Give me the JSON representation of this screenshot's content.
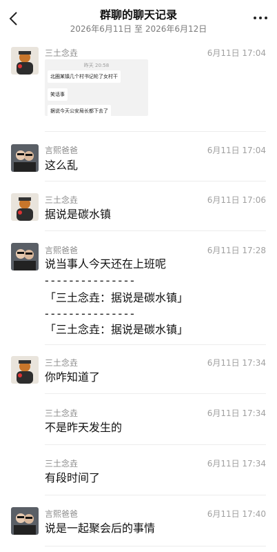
{
  "header": {
    "title": "群聊的聊天记录",
    "date_from": "2026年6月11日",
    "date_sep": "至",
    "date_to": "2026年6月12日",
    "back_icon": "back-chevron-icon",
    "more_icon": "more-dots-icon"
  },
  "quoted_image": {
    "timestamp": "昨天 20:58",
    "lines": [
      "北圈某镇几个村书记轮了女村干",
      "笑话事",
      "据说今天公安局长都下去了"
    ]
  },
  "messages": [
    {
      "sender": "三土念垚",
      "time": "6月11日 17:04",
      "lines": []
    },
    {
      "sender": "言熙爸爸",
      "time": "6月11日 17:04",
      "lines": [
        "这么乱"
      ]
    },
    {
      "sender": "三土念垚",
      "time": "6月11日 17:06",
      "lines": [
        "据说是碳水镇"
      ]
    },
    {
      "sender": "言熙爸爸",
      "time": "6月11日 17:28",
      "lines": [
        "说当事人今天还在上班呢",
        "- - - - - - - - - - - - - - -",
        "「三土念垚：据说是碳水镇」",
        "- - - - - - - - - - - - - - -",
        "「三土念垚：据说是碳水镇」"
      ]
    },
    {
      "sender": "三土念垚",
      "time": "6月11日 17:34",
      "lines": [
        "你咋知道了"
      ]
    },
    {
      "sender": "三土念垚",
      "time": "6月11日 17:34",
      "lines": [
        "不是昨天发生的"
      ]
    },
    {
      "sender": "三土念垚",
      "time": "6月11日 17:34",
      "lines": [
        "有段时间了"
      ]
    },
    {
      "sender": "言熙爸爸",
      "time": "6月11日 17:40",
      "lines": [
        "说是一起聚会后的事情"
      ]
    }
  ],
  "colors": {
    "accent_avatar_a": "#c8762b",
    "accent_avatar_b": "#3a3a3a"
  }
}
